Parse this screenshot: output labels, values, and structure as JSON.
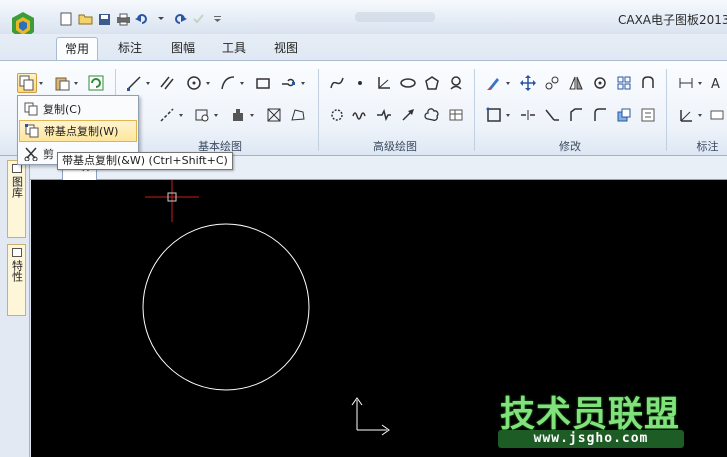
{
  "window": {
    "title": "CAXA电子图板2013"
  },
  "tabs": [
    {
      "label": "常用"
    },
    {
      "label": "标注"
    },
    {
      "label": "图幅"
    },
    {
      "label": "工具"
    },
    {
      "label": "视图"
    }
  ],
  "ribbon_groups": [
    {
      "label": "基本绘图"
    },
    {
      "label": "高级绘图"
    },
    {
      "label": "修改"
    },
    {
      "label": "标注"
    }
  ],
  "copy_menu": {
    "items": [
      {
        "label": "复制(C)"
      },
      {
        "label": "带基点复制(W)"
      },
      {
        "label": "剪"
      }
    ]
  },
  "tooltip": {
    "text": "带基点复制(&W) (Ctrl+Shift+C)"
  },
  "side_panel": {
    "tabs": [
      {
        "label": "图库"
      },
      {
        "label": "特性"
      }
    ]
  },
  "watermark": {
    "text": "技术员联盟",
    "url": "www.jsgho.com"
  },
  "colors": {
    "canvas": "#000000",
    "crosshair": "#cc1a1a",
    "highlight": "#ffe69a",
    "watermark": "#7fe27a"
  }
}
